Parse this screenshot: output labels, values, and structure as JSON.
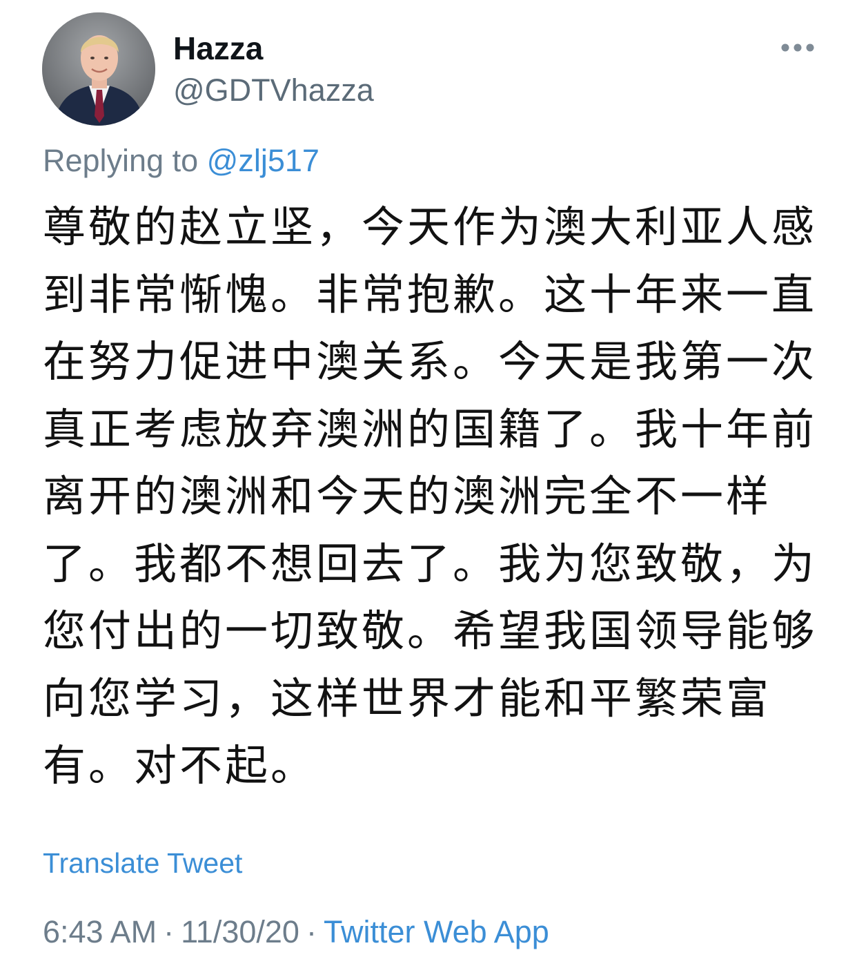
{
  "author": {
    "display_name": "Hazza",
    "handle": "@GDTVhazza",
    "avatar_icon": "profile-photo"
  },
  "more_icon": "more-horizontal-icon",
  "reply": {
    "prefix": "Replying to",
    "mention": "@zlj517"
  },
  "tweet_text": "尊敬的赵立坚，今天作为澳大利亚人感到非常惭愧。非常抱歉。这十年来一直在努力促进中澳关系。今天是我第一次真正考虑放弃澳洲的国籍了。我十年前离开的澳洲和今天的澳洲完全不一样了。我都不想回去了。我为您致敬，为您付出的一切致敬。希望我国领导能够向您学习，这样世界才能和平繁荣富有。对不起。",
  "translate_label": "Translate Tweet",
  "meta": {
    "time": "6:43 AM",
    "separator": "·",
    "date": "11/30/20",
    "source": "Twitter Web App"
  },
  "colors": {
    "link": "#3b8ed6",
    "muted": "#6d7d8b",
    "text": "#0f1419"
  }
}
